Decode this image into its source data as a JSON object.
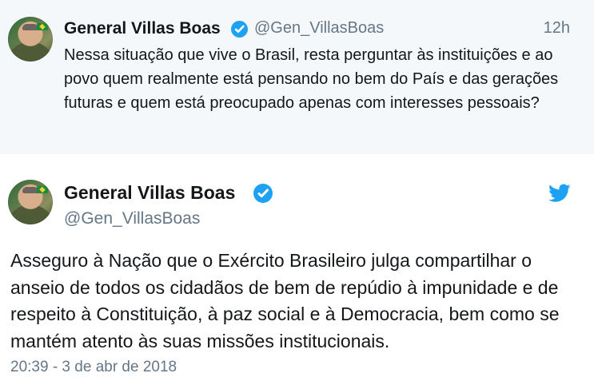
{
  "tweets": [
    {
      "author_name": "General Villas Boas",
      "handle": "@Gen_VillasBoas",
      "time_ago": "12h",
      "text": "Nessa situação que vive o Brasil, resta perguntar às instituições e ao povo quem realmente está pensando no bem do País e das gerações futuras e quem está preocupado apenas com interesses pessoais?"
    },
    {
      "author_name": "General Villas Boas",
      "handle": "@Gen_VillasBoas",
      "text": "Asseguro à Nação que o Exército Brasileiro julga compartilhar o anseio de todos os cidadãos de bem de repúdio à impunidade e de respeito à Constituição, à paz social e à Democracia, bem como se mantém atento às suas missões institucionais.",
      "timestamp": "20:39 - 3 de abr de 2018"
    }
  ],
  "icons": {
    "verified": "verified-badge-icon",
    "platform": "twitter-bird-icon"
  },
  "colors": {
    "accent": "#1da1f2",
    "muted": "#657786",
    "text": "#14171a",
    "top_background": "#f5f8fa"
  }
}
